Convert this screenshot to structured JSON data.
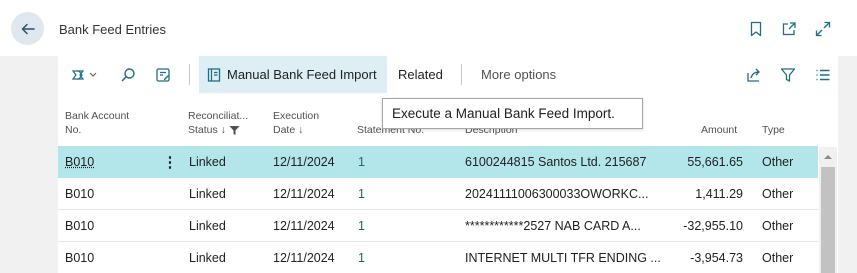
{
  "header": {
    "title": "Bank Feed Entries"
  },
  "toolbar": {
    "manual_label": "Manual Bank Feed Import",
    "related_label": "Related",
    "more_label": "More options"
  },
  "tooltip": "Execute a Manual Bank Feed Import.",
  "columns": {
    "bank_account": [
      "Bank Account",
      "No."
    ],
    "status": [
      "Reconciliat...",
      "Status ↓"
    ],
    "date": [
      "Execution",
      "Date ↓"
    ],
    "statement": "Statement No.",
    "description": "Description",
    "amount": "Amount",
    "type": "Type"
  },
  "rows": [
    {
      "bank": "B010",
      "status": "Linked",
      "date": "12/11/2024",
      "stmt": "1",
      "desc": "6100244815 Santos Ltd. 215687",
      "amount": "55,661.65",
      "type": "Other"
    },
    {
      "bank": "B010",
      "status": "Linked",
      "date": "12/11/2024",
      "stmt": "1",
      "desc": "20241111006300033OWORKC...",
      "amount": "1,411.29",
      "type": "Other"
    },
    {
      "bank": "B010",
      "status": "Linked",
      "date": "12/11/2024",
      "stmt": "1",
      "desc": "************2527 NAB CARD A...",
      "amount": "-32,955.10",
      "type": "Other"
    },
    {
      "bank": "B010",
      "status": "Linked",
      "date": "12/11/2024",
      "stmt": "1",
      "desc": "INTERNET MULTI TFR ENDING ...",
      "amount": "-3,954.73",
      "type": "Other"
    }
  ],
  "colors": {
    "accent": "#1b6a63",
    "selected_row": "#b3e6ea",
    "icon": "#1f6e84"
  },
  "icons": [
    "back-arrow-icon",
    "bookmark-icon",
    "open-new-window-icon",
    "expand-icon",
    "copilot-icon",
    "search-icon",
    "edit-list-icon",
    "import-icon",
    "share-icon",
    "filter-icon",
    "list-view-icon",
    "row-menu-icon",
    "filter-small-icon"
  ]
}
